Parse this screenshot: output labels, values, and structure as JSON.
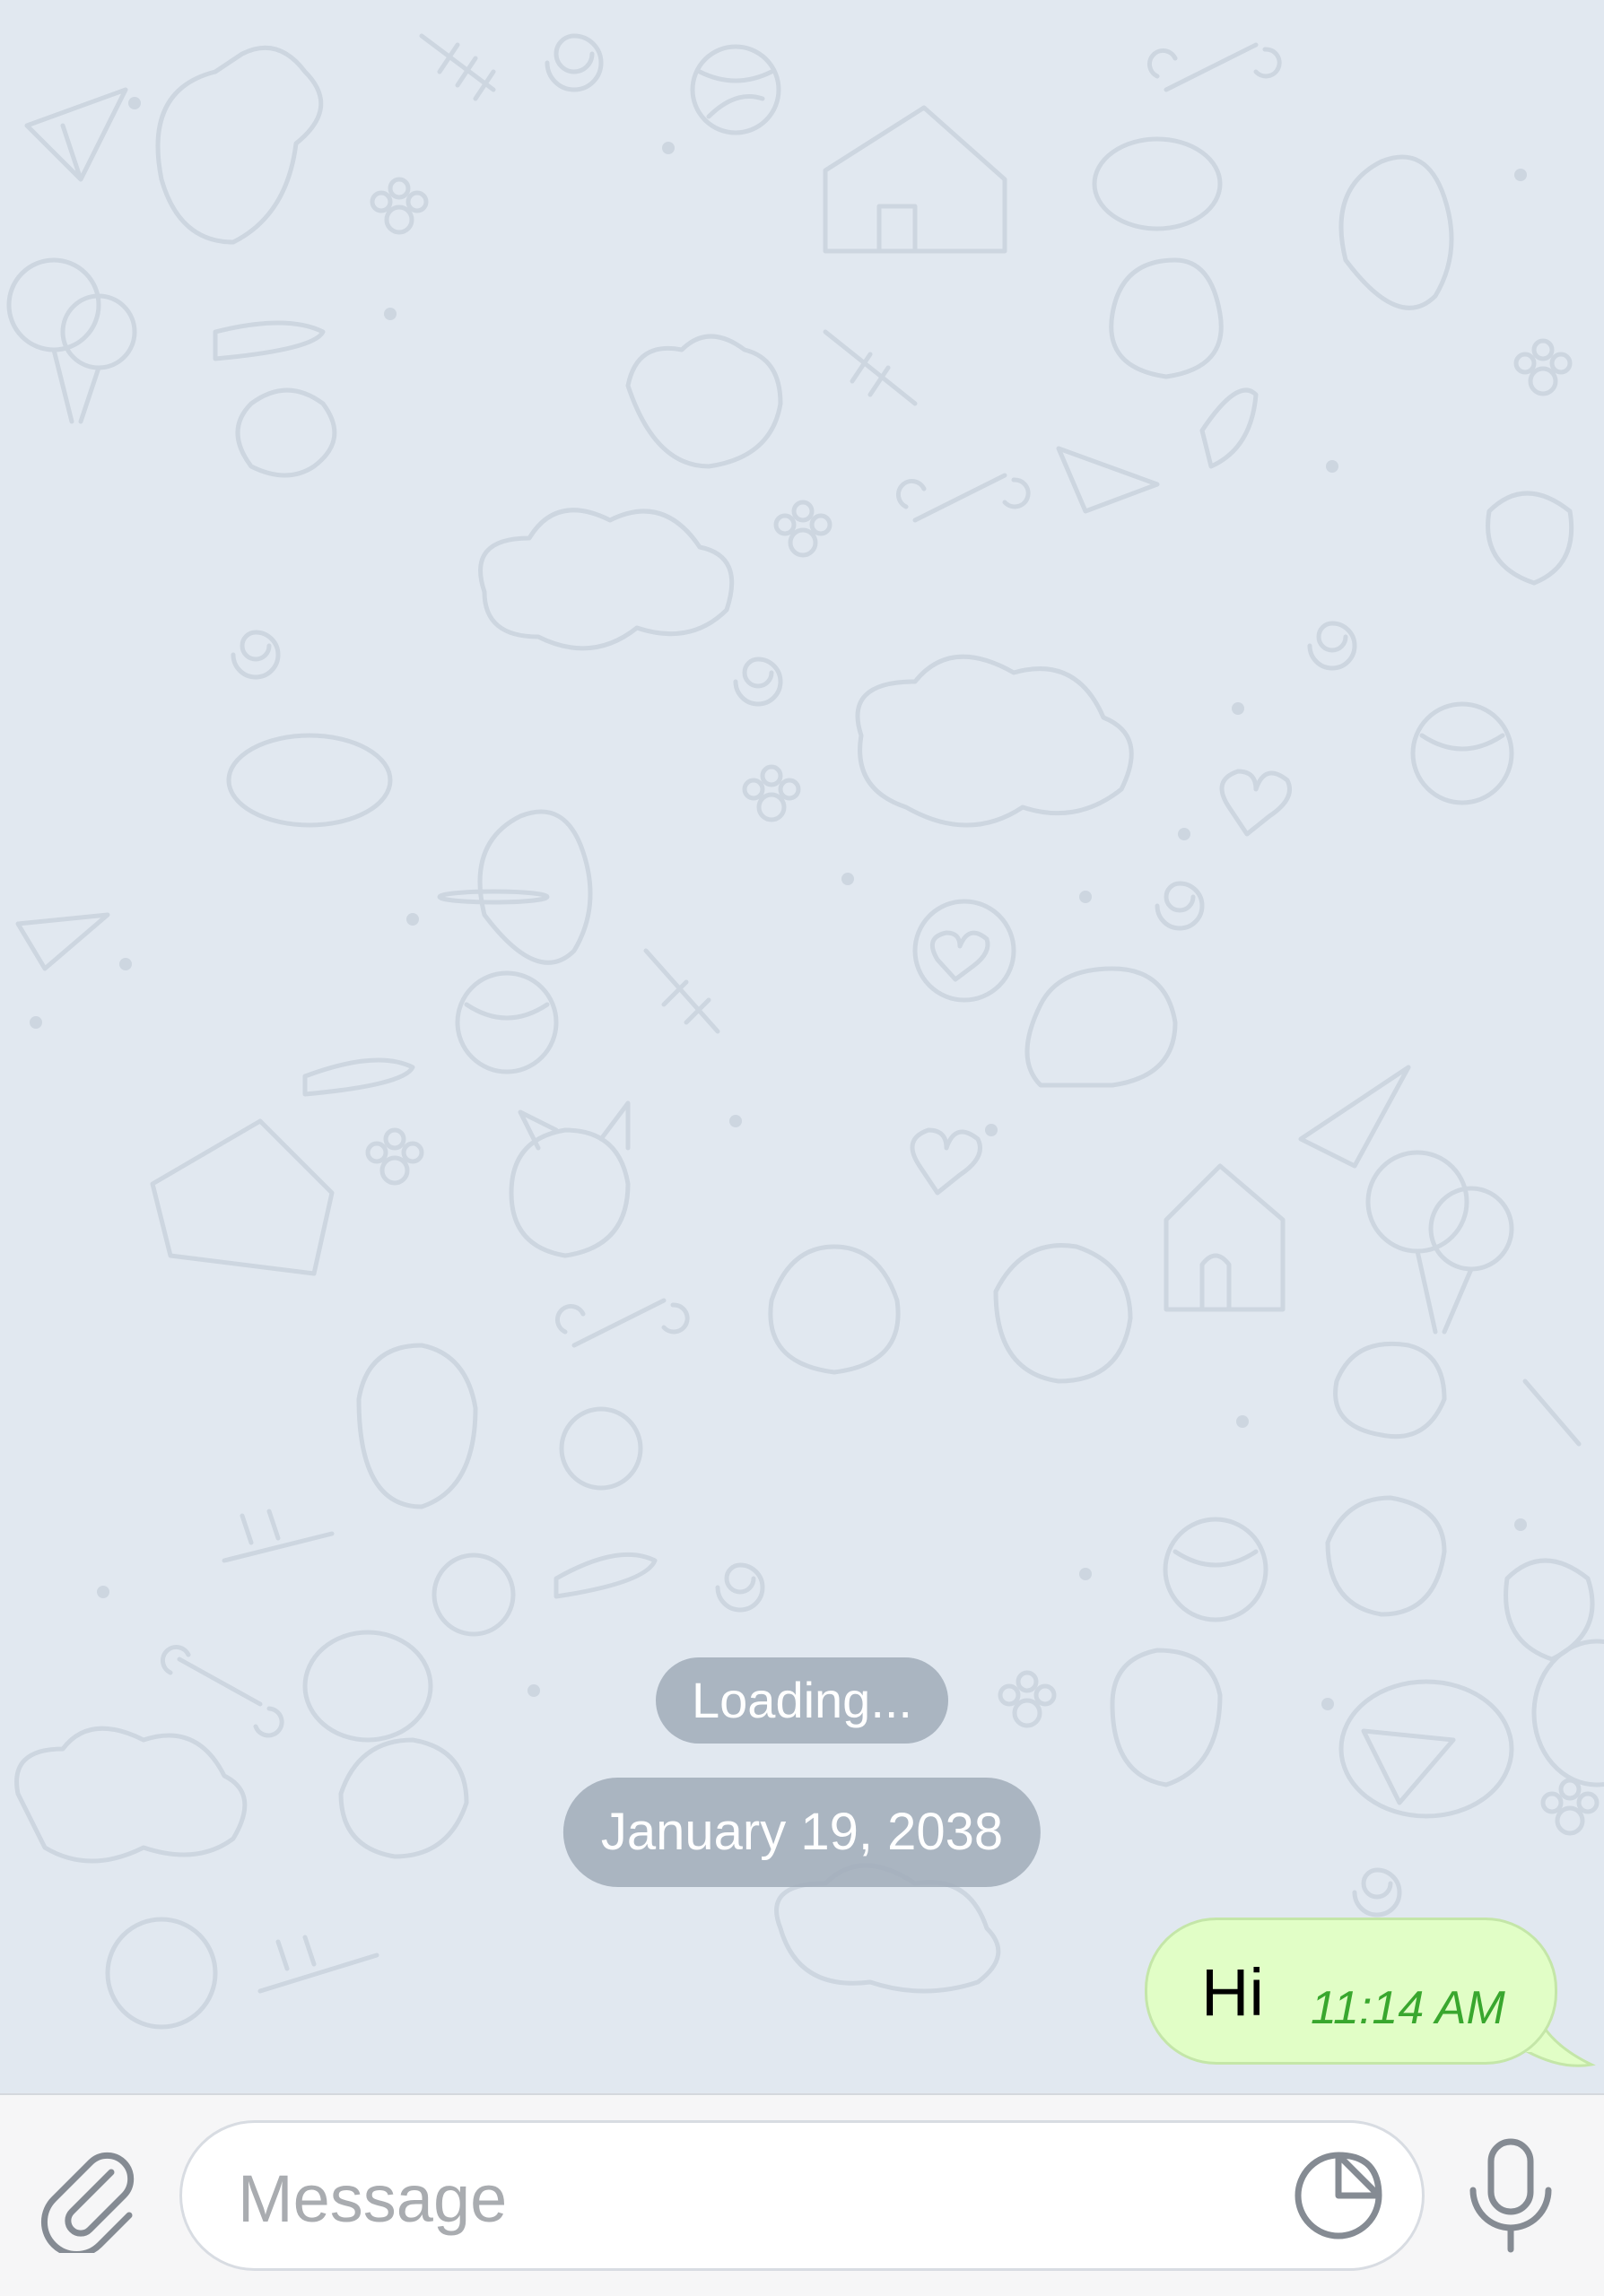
{
  "colors": {
    "background": "#e1e8f0",
    "doodle_stroke": "#cdd6e0",
    "service_pill": "#a0acb8",
    "outgoing_bubble": "#e1fec6",
    "outgoing_time": "#39a72e",
    "input_bar": "#f6f6f7",
    "icon_gray": "#858b93"
  },
  "chat": {
    "service_messages": {
      "loading": "Loading...",
      "date": "January 19, 2038"
    },
    "messages": [
      {
        "direction": "outgoing",
        "text": "Hi",
        "time": "11:14 AM"
      }
    ]
  },
  "input": {
    "attach_icon": "paperclip-icon",
    "placeholder": "Message",
    "sticker_icon": "sticker-icon",
    "mic_icon": "microphone-icon"
  }
}
